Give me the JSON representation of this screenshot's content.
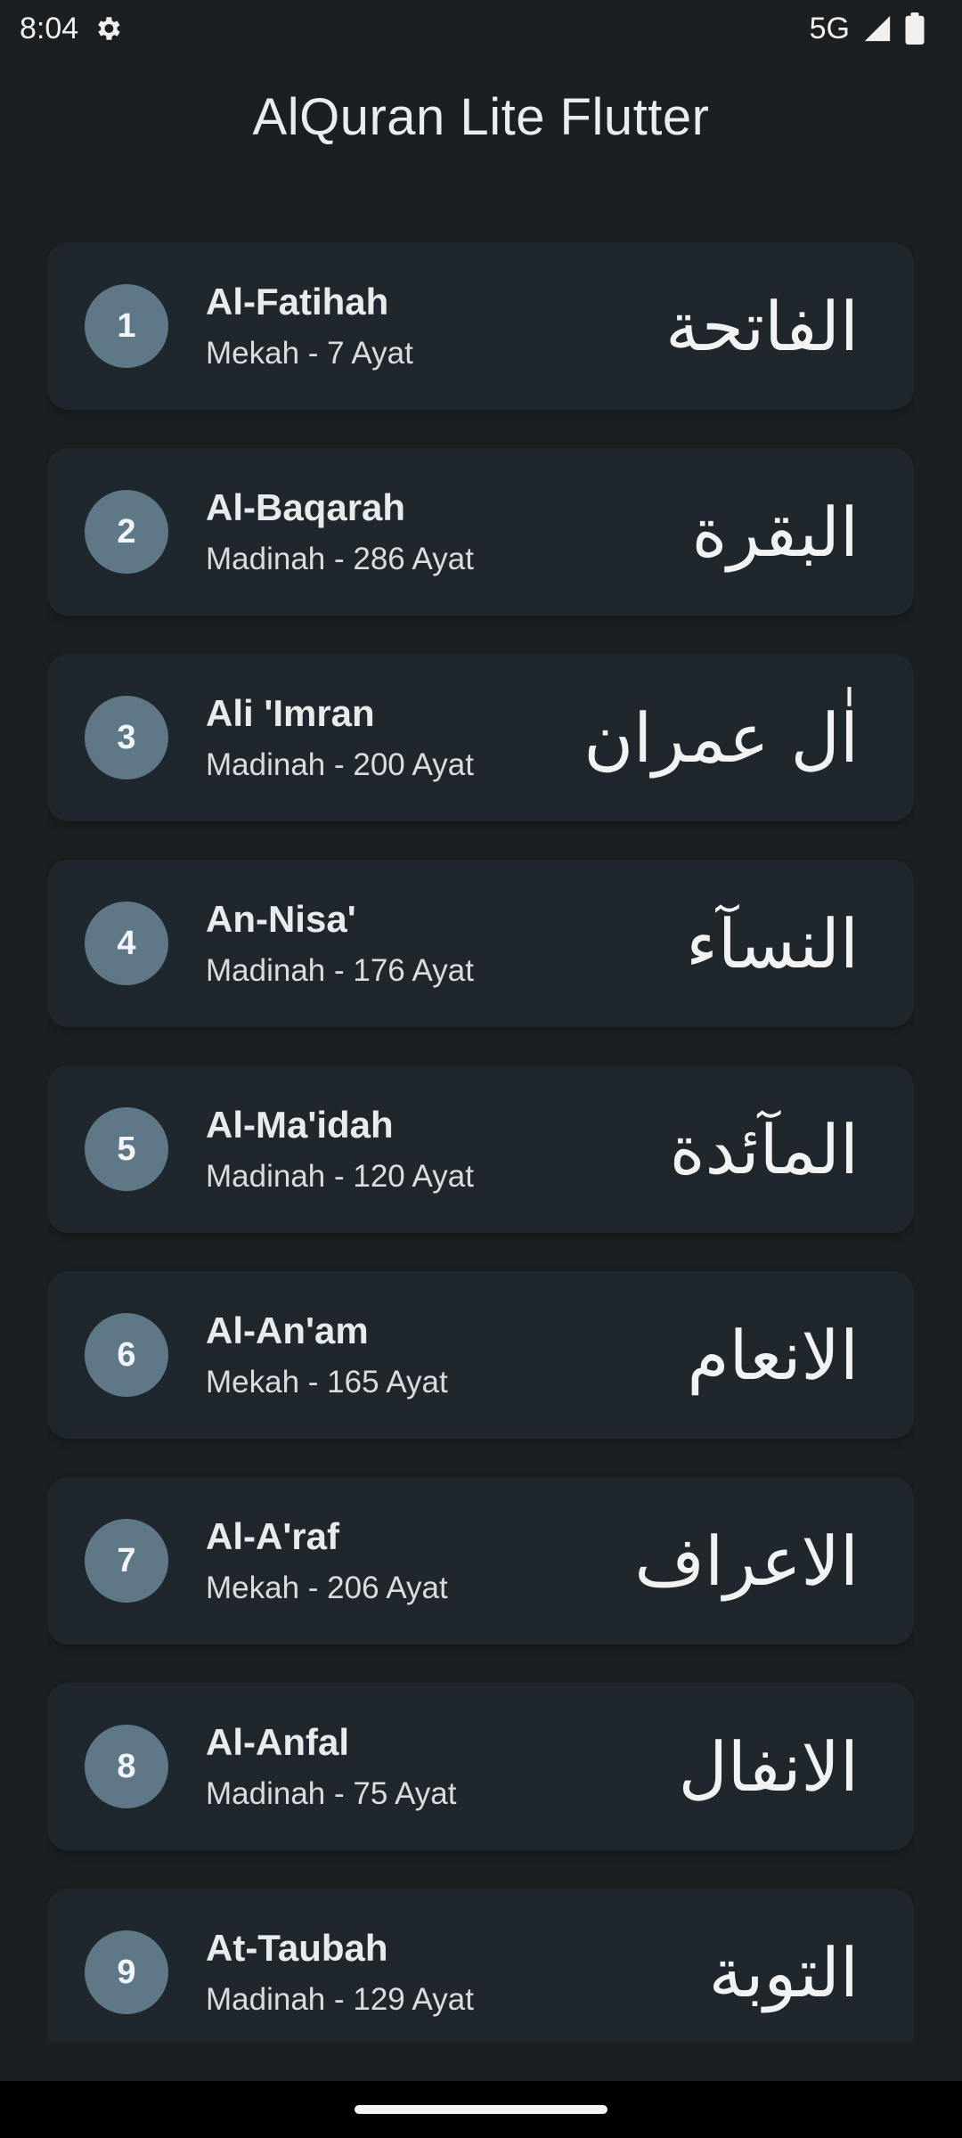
{
  "status_bar": {
    "time": "8:04",
    "network": "5G",
    "icons": [
      "settings-icon",
      "signal-icon",
      "battery-icon"
    ]
  },
  "app": {
    "title": "AlQuran Lite Flutter"
  },
  "colors": {
    "background": "#1b1f22",
    "card": "#20272c",
    "badge": "#5f7888",
    "text": "#e7ebee"
  },
  "surahs": [
    {
      "number": "1",
      "name": "Al-Fatihah",
      "meta": "Mekah - 7 Ayat",
      "arabic": "الفاتحة"
    },
    {
      "number": "2",
      "name": "Al-Baqarah",
      "meta": "Madinah - 286 Ayat",
      "arabic": "البقرة"
    },
    {
      "number": "3",
      "name": "Ali 'Imran",
      "meta": "Madinah - 200 Ayat",
      "arabic": "اٰل عمران"
    },
    {
      "number": "4",
      "name": "An-Nisa'",
      "meta": "Madinah - 176 Ayat",
      "arabic": "النسآء"
    },
    {
      "number": "5",
      "name": "Al-Ma'idah",
      "meta": "Madinah - 120 Ayat",
      "arabic": "المآئدة"
    },
    {
      "number": "6",
      "name": "Al-An'am",
      "meta": "Mekah - 165 Ayat",
      "arabic": "الانعام"
    },
    {
      "number": "7",
      "name": "Al-A'raf",
      "meta": "Mekah - 206 Ayat",
      "arabic": "الاعراف"
    },
    {
      "number": "8",
      "name": "Al-Anfal",
      "meta": "Madinah - 75 Ayat",
      "arabic": "الانفال"
    },
    {
      "number": "9",
      "name": "At-Taubah",
      "meta": "Madinah - 129 Ayat",
      "arabic": "التوبة"
    }
  ]
}
